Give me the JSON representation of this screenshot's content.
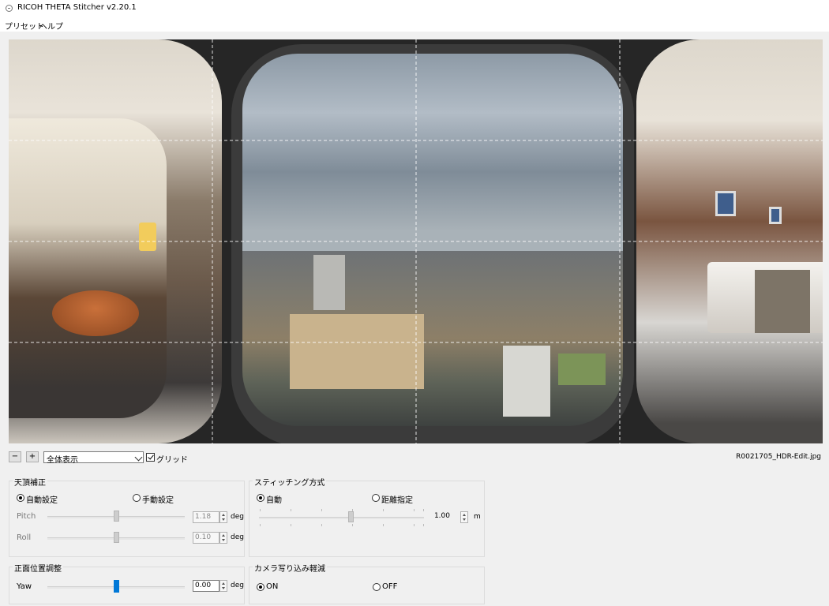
{
  "window": {
    "title": "RICOH THETA Stitcher v2.20.1"
  },
  "menu": [
    {
      "label": "プリセット"
    },
    {
      "label": "ヘルプ"
    }
  ],
  "toolbar": {
    "zoom_out_label": "−",
    "zoom_in_label": "+",
    "view_mode": "全体表示",
    "grid_label": "グリッド",
    "grid_checked": true,
    "filename": "R0021705_HDR-Edit.jpg"
  },
  "zenith": {
    "title": "天頂補正",
    "auto_label": "自動設定",
    "manual_label": "手動設定",
    "selected": "auto",
    "pitch": {
      "label": "Pitch",
      "value": "1.18",
      "unit": "deg"
    },
    "roll": {
      "label": "Roll",
      "value": "0.10",
      "unit": "deg"
    }
  },
  "stitching": {
    "title": "スティッチング方式",
    "auto_label": "自動",
    "distance_label": "距離指定",
    "selected": "auto",
    "distance": {
      "value": "1.00",
      "unit": "m"
    }
  },
  "front": {
    "title": "正面位置調整",
    "yaw": {
      "label": "Yaw",
      "value": "0.00",
      "unit": "deg"
    }
  },
  "camera_reduction": {
    "title": "カメラ写り込み軽減",
    "on_label": "ON",
    "off_label": "OFF",
    "selected": "on"
  }
}
